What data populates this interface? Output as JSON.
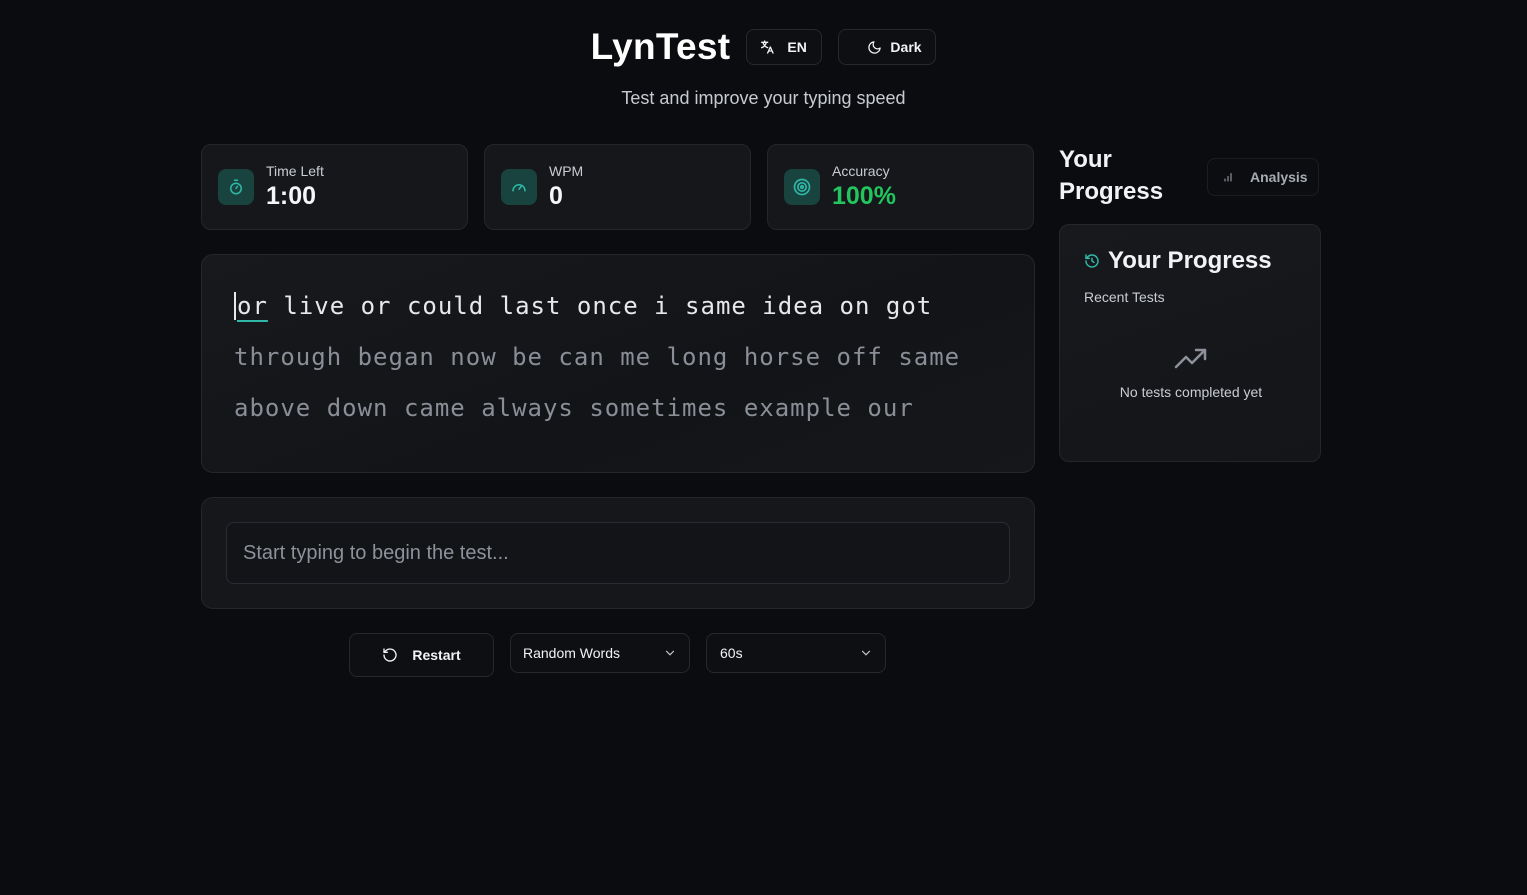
{
  "header": {
    "logo": "LynTest",
    "language_button": "EN",
    "theme_button": "Dark",
    "subtitle": "Test and improve your typing speed"
  },
  "stats": {
    "time": {
      "label": "Time Left",
      "value": "1:00"
    },
    "wpm": {
      "label": "WPM",
      "value": "0"
    },
    "accuracy": {
      "label": "Accuracy",
      "value": "100%"
    }
  },
  "text": {
    "current_word": "or",
    "line1_rest": "live or could last once i same idea on got",
    "line2": "through began now be can me long horse off same",
    "line3": "above down came always sometimes example our"
  },
  "input": {
    "placeholder": "Start typing to begin the test...",
    "value": ""
  },
  "controls": {
    "restart_label": "Restart",
    "mode_selected": "Random Words",
    "duration_selected": "60s"
  },
  "progress": {
    "heading": "Your Progress",
    "analysis_button": "Analysis",
    "card_title": "Your Progress",
    "recent_label": "Recent Tests",
    "empty_message": "No tests completed yet"
  },
  "colors": {
    "accent": "#2fb8a8",
    "accuracy_green": "#22c55e",
    "background": "#0b0c0f"
  }
}
